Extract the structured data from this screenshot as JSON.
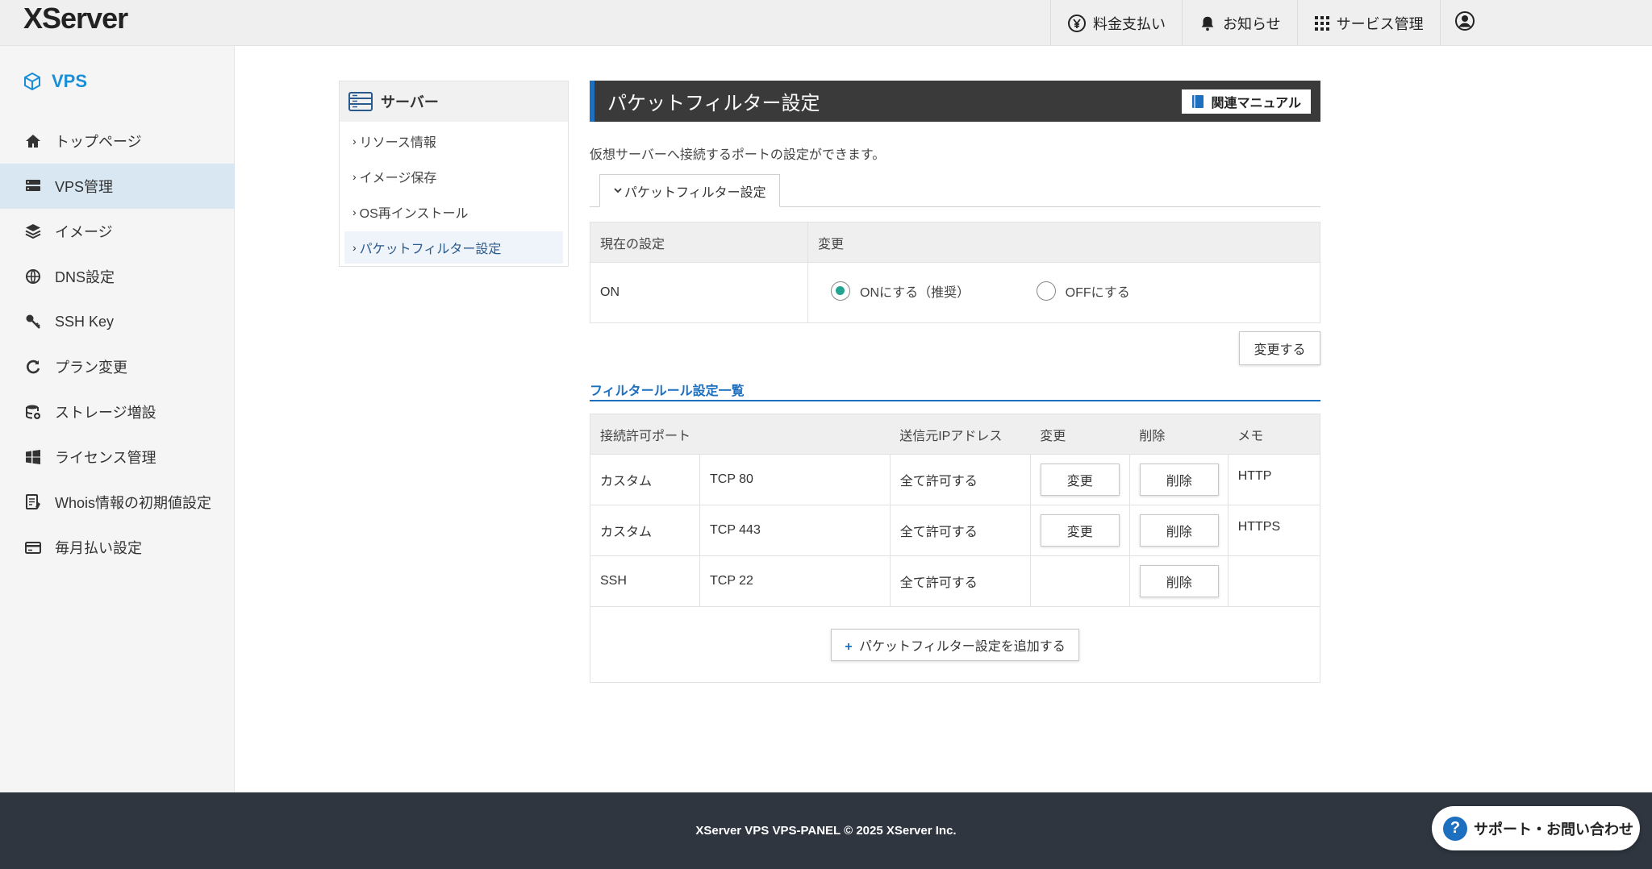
{
  "header": {
    "logo": "XServer",
    "nav": [
      {
        "label": "料金支払い",
        "icon": "yen-icon"
      },
      {
        "label": "お知らせ",
        "icon": "bell-icon"
      },
      {
        "label": "サービス管理",
        "icon": "grid-icon"
      }
    ],
    "user_icon": "user-icon"
  },
  "sidebar": {
    "brand": "VPS",
    "items": [
      {
        "label": "トップページ",
        "icon": "home-icon"
      },
      {
        "label": "VPS管理",
        "icon": "server-icon",
        "active": true
      },
      {
        "label": "イメージ",
        "icon": "layers-icon"
      },
      {
        "label": "DNS設定",
        "icon": "globe-icon"
      },
      {
        "label": "SSH Key",
        "icon": "key-icon"
      },
      {
        "label": "プラン変更",
        "icon": "refresh-icon"
      },
      {
        "label": "ストレージ増設",
        "icon": "database-icon"
      },
      {
        "label": "ライセンス管理",
        "icon": "windows-icon"
      },
      {
        "label": "Whois情報の初期値設定",
        "icon": "document-icon"
      },
      {
        "label": "毎月払い設定",
        "icon": "card-icon"
      }
    ]
  },
  "submenu": {
    "title": "サーバー",
    "items": [
      {
        "label": "リソース情報"
      },
      {
        "label": "イメージ保存"
      },
      {
        "label": "OS再インストール"
      },
      {
        "label": "パケットフィルター設定",
        "active": true
      }
    ]
  },
  "main": {
    "title": "パケットフィルター設定",
    "manual_button": "関連マニュアル",
    "description": "仮想サーバーへ接続するポートの設定ができます。",
    "tab": "パケットフィルター設定",
    "settings_table": {
      "headers": [
        "現在の設定",
        "変更"
      ],
      "current": "ON",
      "options": [
        {
          "label": "ONにする（推奨）",
          "checked": true
        },
        {
          "label": "OFFにする",
          "checked": false
        }
      ]
    },
    "change_button": "変更する",
    "rules_title": "フィルタールール設定一覧",
    "rules_headers": [
      "接続許可ポート",
      "送信元IPアドレス",
      "変更",
      "削除",
      "メモ"
    ],
    "rules": [
      {
        "type": "カスタム",
        "port": "TCP 80",
        "source": "全て許可する",
        "edit": "変更",
        "delete": "削除",
        "memo": "HTTP"
      },
      {
        "type": "カスタム",
        "port": "TCP 443",
        "source": "全て許可する",
        "edit": "変更",
        "delete": "削除",
        "memo": "HTTPS"
      },
      {
        "type": "SSH",
        "port": "TCP 22",
        "source": "全て許可する",
        "edit": "",
        "delete": "削除",
        "memo": ""
      }
    ],
    "add_button": "パケットフィルター設定を追加する"
  },
  "footer": {
    "copyright": "XServer VPS VPS-PANEL © 2025 XServer Inc."
  },
  "support_button": "サポート・お問い合わせ",
  "colors": {
    "accent": "#1d6fbf",
    "radio_on": "#23a391",
    "title_bar": "#3a3a3a",
    "footer": "#2f3640"
  }
}
